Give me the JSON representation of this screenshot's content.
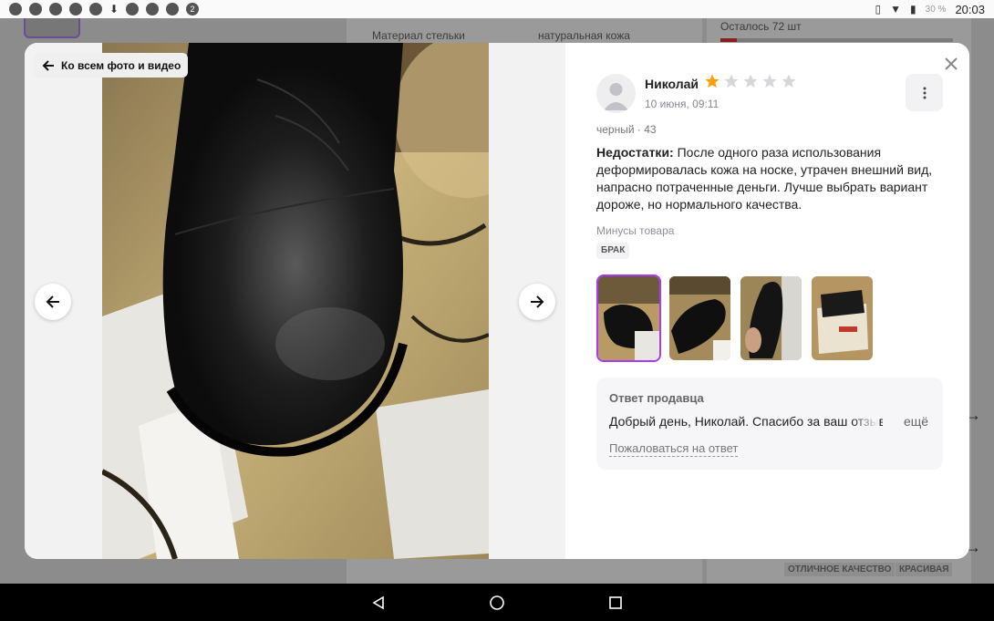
{
  "status_bar": {
    "time": "20:03",
    "battery": "30 %"
  },
  "background": {
    "insole_label": "Материал стельки",
    "insole_value": "натуральная кожа",
    "stock": "Осталось 72 шт",
    "tags": [
      "ОТЛИЧНОЕ КАЧЕСТВО",
      "КРАСИВАЯ"
    ]
  },
  "modal": {
    "back_label": "Ко всем фото и видео",
    "review": {
      "author": "Николай",
      "rating": 1,
      "rating_max": 5,
      "date": "10 июня, 09:11",
      "variant": "черный · 43",
      "text_label": "Недостатки:",
      "text": "После одного раза использования деформировалась кожа на носке, утрачен внешний вид, напрасно потраченные деньги. Лучше выбрать вариант дороже, но нормального качества.",
      "cons_label": "Минусы товара",
      "cons_tag": "БРАК",
      "photo_count": 4
    },
    "seller": {
      "title": "Ответ продавца",
      "text": "Добрый день, Николай. Спасибо за ваш отзыв. Нам",
      "more": "ещё",
      "complain": "Пожаловаться на ответ"
    }
  },
  "colors": {
    "accent": "#a73afd",
    "star_filled": "#ff9d0a",
    "star_empty": "#d6d6db"
  }
}
